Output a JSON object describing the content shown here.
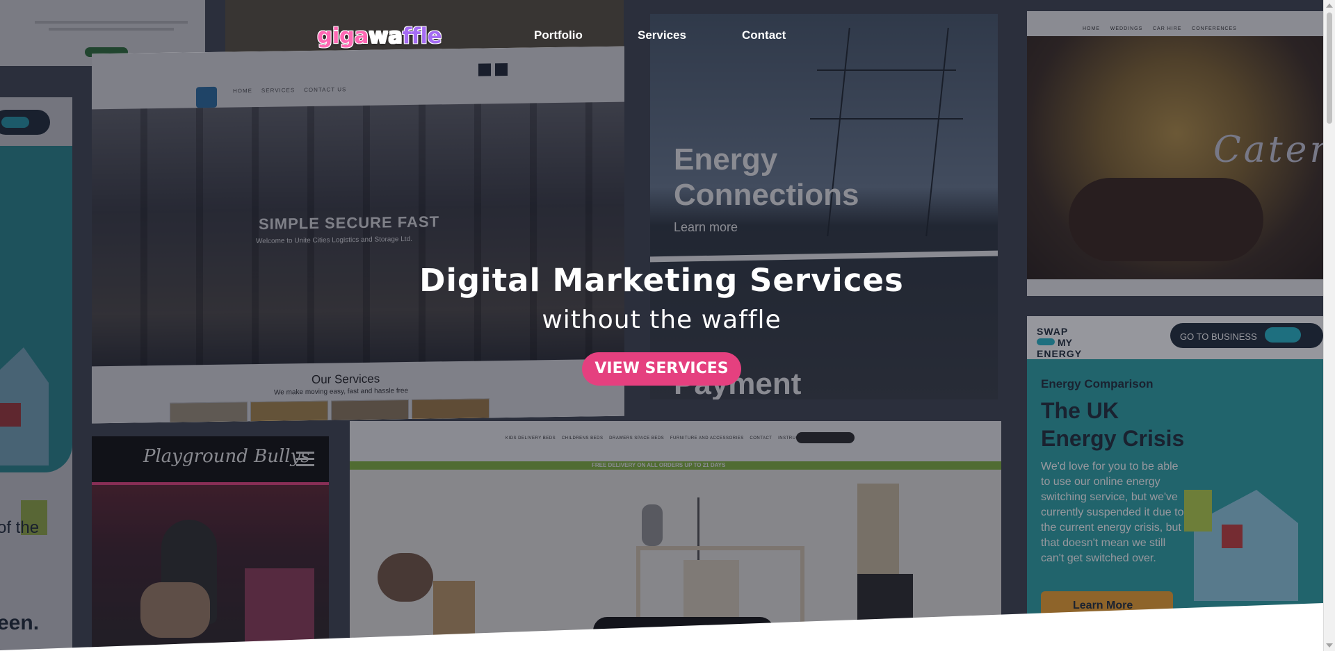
{
  "header": {
    "logo": {
      "part1": "giga",
      "part2": "wa",
      "part3": "ffle"
    },
    "nav": [
      {
        "label": "Portfolio"
      },
      {
        "label": "Services"
      },
      {
        "label": "Contact"
      }
    ]
  },
  "hero": {
    "title": "Digital Marketing Services",
    "subtitle": "without the waffle",
    "cta_label": "VIEW SERVICES"
  },
  "portfolio": {
    "logistics": {
      "nav": [
        "HOME",
        "SERVICES",
        "CONTACT US"
      ],
      "headline": "SIMPLE SECURE FAST",
      "tagline": "Welcome to Unite Cities Logistics and Storage Ltd.",
      "services_title": "Our Services",
      "services_sub": "We make moving easy, fast and hassle free"
    },
    "energy": {
      "headline_1": "Energy",
      "headline_2": "Connections",
      "link": "Learn more",
      "word_2": "Payment"
    },
    "catering": {
      "nav": [
        "HOME",
        "WEDDINGS",
        "CAR HIRE",
        "CONFERENCES"
      ],
      "script": "Catering"
    },
    "swap": {
      "brand_1": "SWAP",
      "brand_2": "MY",
      "brand_3": "ENERGY",
      "toggle": "GO TO BUSINESS",
      "kicker": "Energy Comparison",
      "title_1": "The UK",
      "title_2": "Energy Crisis",
      "body": "We'd love for you to be able to use our online energy switching service, but we've currently suspended it due to the current energy crisis, but that doesn't mean we still can't get switched over.",
      "button": "Learn More"
    },
    "bullys": {
      "title": "Playground Bullys"
    },
    "shop": {
      "nav": [
        "KIDS DELIVERY BEDS",
        "CHILDRENS BEDS",
        "DRAWERS SPACE BEDS",
        "FURNITURE AND ACCESSORIES",
        "CONTACT",
        "INSTRUCTIONS"
      ],
      "banner": "FREE DELIVERY ON ALL ORDERS UP TO 21 DAYS"
    },
    "left": {
      "text_1": "of the",
      "text_2": "een."
    }
  },
  "colors": {
    "accent": "#e5407f",
    "logo_pink": "#ff69b4",
    "logo_purple": "#a56cf3"
  }
}
